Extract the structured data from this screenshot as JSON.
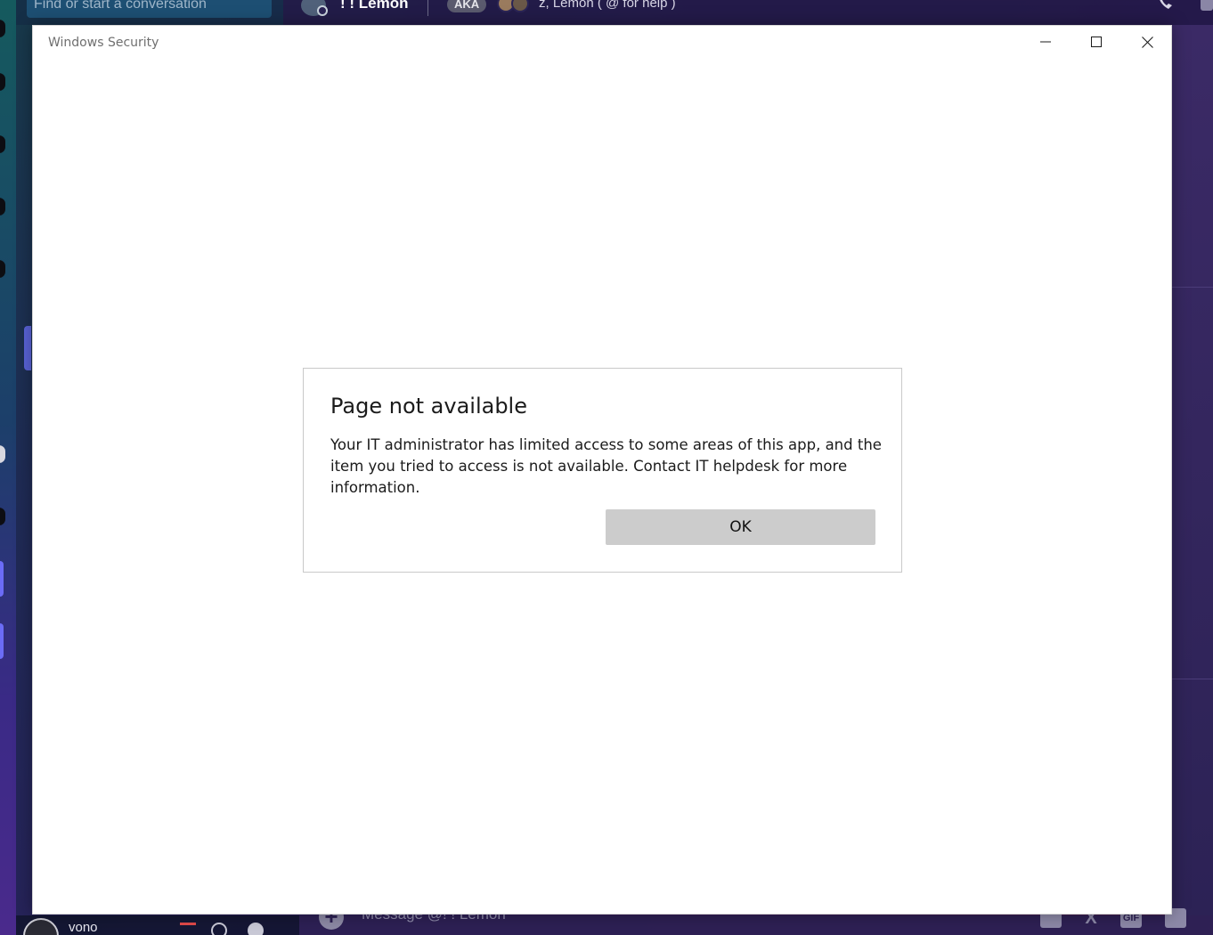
{
  "background_app": {
    "search": {
      "placeholder": "Find or start a conversation"
    },
    "chat_header": {
      "name": "! ! Lemon",
      "aka_badge": "AKA",
      "nicknames": "z, Lemon ( @ for help )"
    },
    "user_panel": {
      "username": "vono"
    },
    "message_input": {
      "placeholder": "Message @! ! Lemon"
    },
    "message_icons": [
      "gift-icon",
      "translate-icon",
      "gif-icon",
      "sticker-icon"
    ],
    "gif_label": "GIF"
  },
  "window": {
    "title": "Windows Security",
    "controls": [
      "minimize-icon",
      "maximize-icon",
      "close-icon"
    ]
  },
  "dialog": {
    "title": "Page not available",
    "body": "Your IT administrator has limited access to some areas of this app, and the item you tried to access is not available. Contact IT helpdesk for more information.",
    "ok_label": "OK"
  },
  "colors": {
    "window_bg": "#ffffff",
    "ok_button_bg": "#cccccc",
    "title_text": "#6f6f6f",
    "bg_gradient_start": "#173a4a",
    "bg_gradient_end": "#4a2350"
  }
}
